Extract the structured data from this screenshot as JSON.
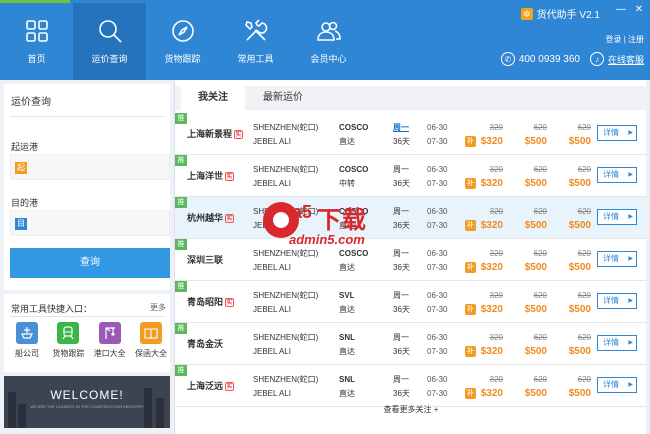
{
  "app": {
    "title": "货代助手 V2.1",
    "logo_glyph": "✲"
  },
  "window_controls": {
    "minimize": "—",
    "close": "✕"
  },
  "nav": [
    {
      "label": "首页",
      "icon": "grid-icon"
    },
    {
      "label": "运价查询",
      "icon": "search-icon"
    },
    {
      "label": "货物跟踪",
      "icon": "compass-icon"
    },
    {
      "label": "常用工具",
      "icon": "tools-icon"
    },
    {
      "label": "会员中心",
      "icon": "users-icon"
    }
  ],
  "auth": {
    "login": "登录",
    "sep": "|",
    "register": "注册"
  },
  "contact": {
    "phone": "400 0939 360",
    "service": "在线客服"
  },
  "query": {
    "title": "运价查询",
    "origin_label": "起运港",
    "origin_tag": "起",
    "dest_label": "目的港",
    "dest_tag": "目",
    "button": "查询"
  },
  "tools": {
    "title": "常用工具快捷入口：",
    "more": "更多",
    "items": [
      {
        "label": "船公司",
        "icon": "ship-icon",
        "color": "#4a90d9"
      },
      {
        "label": "货物跟踪",
        "icon": "train-icon",
        "color": "#39b54a"
      },
      {
        "label": "港口大全",
        "icon": "crane-icon",
        "color": "#9b59b6"
      },
      {
        "label": "保函大全",
        "icon": "book-icon",
        "color": "#f39c23"
      }
    ]
  },
  "banner": {
    "title": "WELCOME!",
    "subtitle": "WE ARE THE LEADERS IN THE CONSTRUCTION INDUSTRY"
  },
  "tabs": [
    "我关注",
    "最新运价"
  ],
  "row_tag": "推",
  "shi_tag": "实",
  "badge": "补",
  "detail_label": "详情",
  "rows": [
    {
      "company": "上海新景程",
      "shi": true,
      "pol": "SHENZHEN(蛇口)",
      "pod": "JEBEL ALI",
      "carrier": "COSCO",
      "route": "直达",
      "week": "周一",
      "week_link": true,
      "days": "36天",
      "d1": "06-30",
      "d2": "07-30",
      "p20_old": "320",
      "p20_new": "$320",
      "p40_old": "620",
      "p40_new": "$500",
      "p40h_old": "620",
      "p40h_new": "$500",
      "highlight": false
    },
    {
      "company": "上海洋世",
      "shi": true,
      "pol": "SHENZHEN(蛇口)",
      "pod": "JEBEL ALI",
      "carrier": "COSCO",
      "route": "中转",
      "week": "周一",
      "week_link": false,
      "days": "36天",
      "d1": "06-30",
      "d2": "07-30",
      "p20_old": "320",
      "p20_new": "$320",
      "p40_old": "620",
      "p40_new": "$500",
      "p40h_old": "620",
      "p40h_new": "$500",
      "highlight": false
    },
    {
      "company": "杭州越华",
      "shi": true,
      "pol": "SHENZHEN(蛇口)",
      "pod": "JEBEL ALI",
      "carrier": "COSCO",
      "route": "直达",
      "week": "周一",
      "week_link": false,
      "days": "36天",
      "d1": "06-30",
      "d2": "07-30",
      "p20_old": "320",
      "p20_new": "$320",
      "p40_old": "620",
      "p40_new": "$500",
      "p40h_old": "620",
      "p40h_new": "$500",
      "highlight": true
    },
    {
      "company": "深圳三联",
      "shi": false,
      "pol": "SHENZHEN(蛇口)",
      "pod": "JEBEL ALI",
      "carrier": "COSCO",
      "route": "直达",
      "week": "周一",
      "week_link": false,
      "days": "36天",
      "d1": "06-30",
      "d2": "07-30",
      "p20_old": "320",
      "p20_new": "$320",
      "p40_old": "620",
      "p40_new": "$500",
      "p40h_old": "620",
      "p40h_new": "$500",
      "highlight": false
    },
    {
      "company": "青岛昭阳",
      "shi": true,
      "pol": "SHENZHEN(蛇口)",
      "pod": "JEBEL ALI",
      "carrier": "SVL",
      "route": "直达",
      "week": "周一",
      "week_link": false,
      "days": "36天",
      "d1": "06-30",
      "d2": "07-30",
      "p20_old": "320",
      "p20_new": "$320",
      "p40_old": "620",
      "p40_new": "$500",
      "p40h_old": "620",
      "p40h_new": "$500",
      "highlight": false
    },
    {
      "company": "青岛金沃",
      "shi": false,
      "pol": "SHENZHEN(蛇口)",
      "pod": "JEBEL ALI",
      "carrier": "SNL",
      "route": "直达",
      "week": "周一",
      "week_link": false,
      "days": "36天",
      "d1": "06-30",
      "d2": "07-30",
      "p20_old": "320",
      "p20_new": "$320",
      "p40_old": "620",
      "p40_new": "$500",
      "p40h_old": "620",
      "p40h_new": "$500",
      "highlight": false
    },
    {
      "company": "上海泛远",
      "shi": true,
      "pol": "SHENZHEN(蛇口)",
      "pod": "JEBEL ALI",
      "carrier": "SNL",
      "route": "直达",
      "week": "周一",
      "week_link": false,
      "days": "36天",
      "d1": "06-30",
      "d2": "07-30",
      "p20_old": "320",
      "p20_new": "$320",
      "p40_old": "620",
      "p40_new": "$500",
      "p40h_old": "620",
      "p40h_new": "$500",
      "highlight": false
    }
  ],
  "more_label": "查看更多关注 +",
  "watermark": {
    "logo": "a5",
    "text": "下载",
    "domain": "admin5.com"
  },
  "colors": {
    "header": "#2f86d4",
    "active_nav": "#2573bd",
    "accent": "#3398e3",
    "price": "#f08a1c",
    "watermark": "#d8282d"
  }
}
